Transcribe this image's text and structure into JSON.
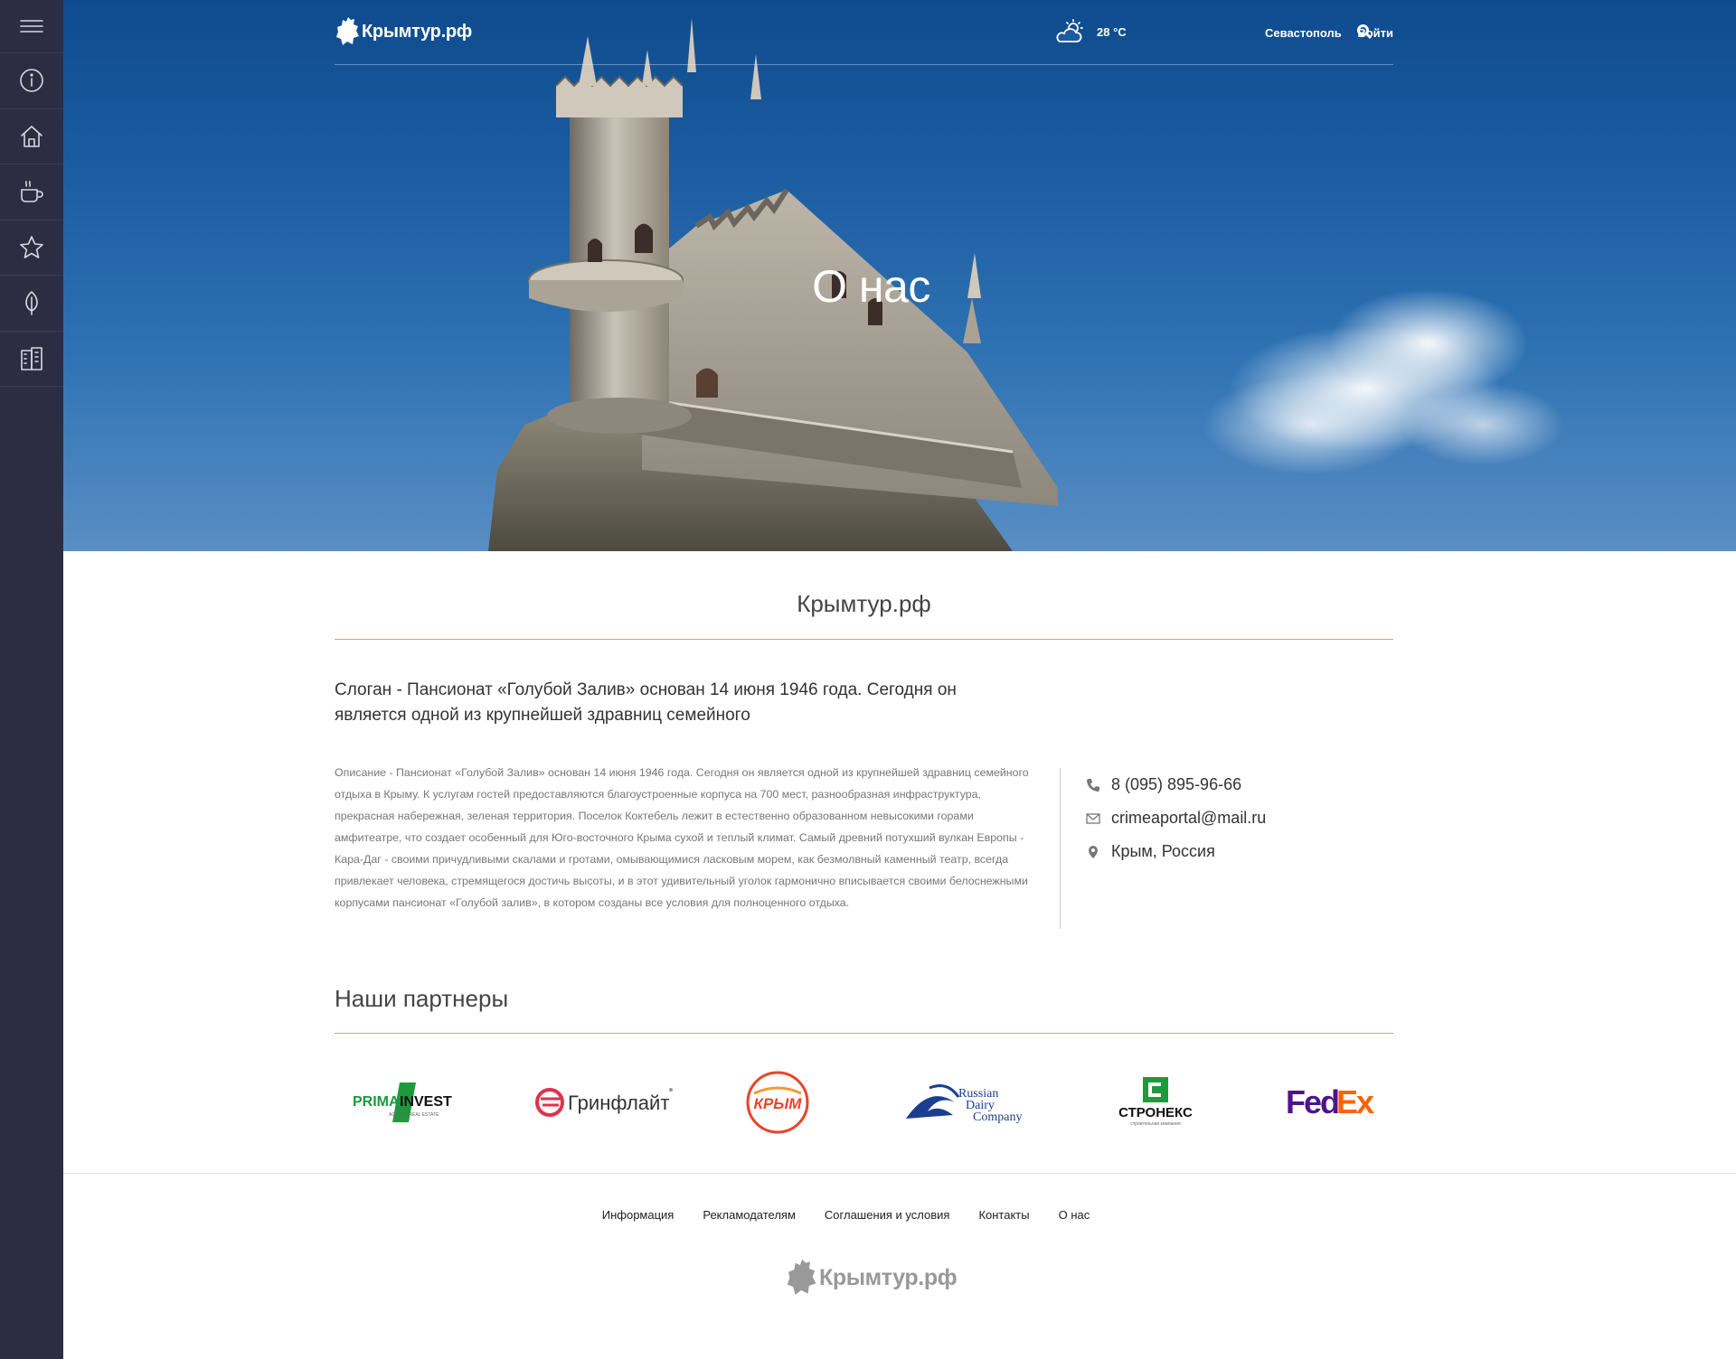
{
  "sidebar": {
    "items": [
      {
        "icon": "menu-icon"
      },
      {
        "icon": "info-icon"
      },
      {
        "icon": "home-icon"
      },
      {
        "icon": "coffee-cup-icon"
      },
      {
        "icon": "star-icon"
      },
      {
        "icon": "leaf-icon"
      },
      {
        "icon": "buildings-icon"
      }
    ]
  },
  "header": {
    "logo_text": "Крымтур.рф",
    "weather_temp": "28 °C",
    "weather_icon": "partly-cloudy-icon",
    "city": "Севастополь",
    "login_label": "Войти"
  },
  "hero": {
    "title": "О нас"
  },
  "about": {
    "site_title": "Крымтур.рф",
    "slogan": "Слоган - Пансионат «Голубой Залив» основан 14 июня 1946 года. Сегодня он является одной из крупнейшей здравниц семейного",
    "description": "Описание - Пансионат «Голубой Залив» основан 14 июня 1946 года. Сегодня он является одной из крупнейшей здравниц семейного отдыха в Крыму. К услугам гостей предоставляются благоустроенные корпуса на 700 мест, разнообразная инфраструктура, прекрасная набережная, зеленая территория. Поселок Коктебель лежит в естественно образованном невысокими горами амфитеатре, что создает особенный для Юго-восточного Крыма сухой и теплый климат. Самый древний потухший вулкан Европы - Кара-Даг - своими причудливыми скалами и гротами, омывающимися ласковым морем, как безмолвный каменный театр, всегда привлекает человека, стремящегося достичь высоты, и в этот удивительный уголок гармонично вписывается своими белоснежными корпусами пансионат «Голубой залив», в котором созданы все условия для полноценного отдыха.",
    "contacts": {
      "phone": "8 (095) 895-96-66",
      "email": "crimeaportal@mail.ru",
      "location": "Крым, Россия"
    }
  },
  "partners": {
    "title": "Наши партнеры",
    "logos": [
      {
        "name": "PRIMAINVEST",
        "text1": "PRIMA",
        "text2": "INVEST",
        "sub": "AGENCY REAL ESTATE"
      },
      {
        "name": "Гринфлайт",
        "text": "Гринфлайт"
      },
      {
        "name": "Крым",
        "text": "КРЫМ"
      },
      {
        "name": "Russian Dairy Company",
        "line1": "Russian",
        "line2": "Dairy",
        "line3": "Company"
      },
      {
        "name": "Стронекс",
        "text": "СТРОНЕКС",
        "sub": "строительная компания"
      },
      {
        "name": "FedEx",
        "text1": "Fed",
        "text2": "Ex"
      }
    ]
  },
  "footer": {
    "links": [
      "Информация",
      "Рекламодателям",
      "Соглашения и условия",
      "Контакты",
      "О нас"
    ],
    "logo_text": "Крымтур.рф"
  },
  "colors": {
    "sidebar_bg": "#2c2d42",
    "accent_rule": "#d6a477",
    "sky_top": "#0f4b8e",
    "sky_bottom": "#5a8ec4"
  }
}
